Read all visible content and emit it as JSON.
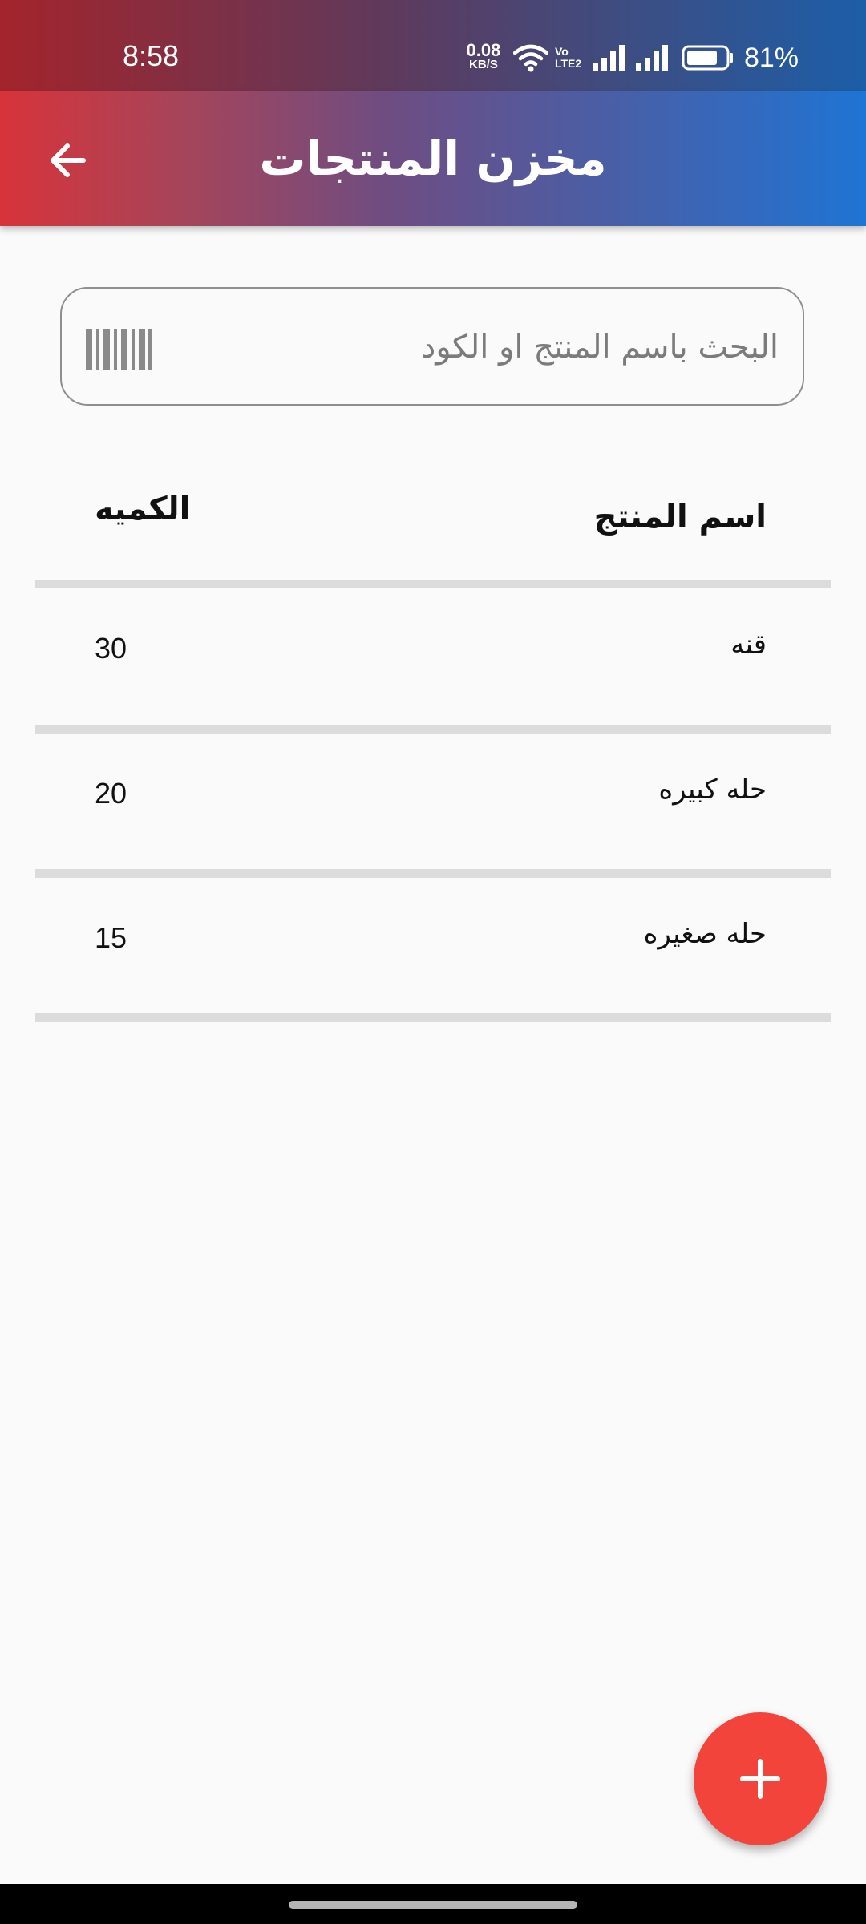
{
  "status_bar": {
    "time": "8:58",
    "net_speed_value": "0.08",
    "net_speed_unit": "KB/S",
    "volte_line1": "Vo",
    "volte_line2": "LTE2",
    "battery_percent": "81%",
    "battery_level": 0.81
  },
  "app_bar": {
    "title": "مخزن المنتجات",
    "back_icon": "arrow-back-icon"
  },
  "search": {
    "placeholder": "البحث باسم المنتج او الكود",
    "value": "",
    "scan_icon": "barcode-icon"
  },
  "table": {
    "headers": {
      "name": "اسم المنتج",
      "quantity": "الكميه"
    },
    "rows": [
      {
        "name": "قنه",
        "quantity": "30"
      },
      {
        "name": "حله كبيره",
        "quantity": "20"
      },
      {
        "name": "حله صغيره",
        "quantity": "15"
      }
    ]
  },
  "fab": {
    "icon": "plus-icon"
  },
  "colors": {
    "accent": "#F2443A",
    "app_bar_start": "#D8333A",
    "app_bar_end": "#1F74D4",
    "divider": "#DCDCDC"
  }
}
